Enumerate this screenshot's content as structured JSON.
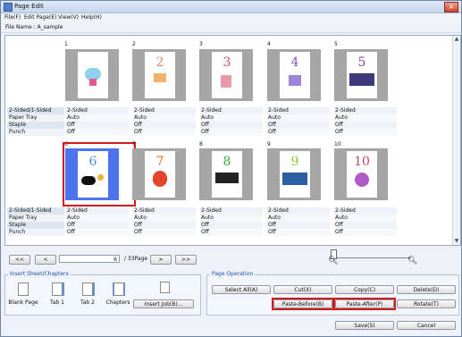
{
  "window": {
    "title": "Page Edit",
    "close_glyph": "×"
  },
  "menu": {
    "items": [
      "File(F)",
      "Edit Page(E)",
      "View(V)",
      "Help(H)"
    ]
  },
  "file_name": "File Name : A_sample",
  "row_labels": [
    "2-Sided/1-Sided",
    "Paper Tray",
    "Staple",
    "Punch"
  ],
  "pages": [
    {
      "num": "1",
      "glyph": "",
      "values": [
        "2-Sided",
        "Auto",
        "Off",
        "Off"
      ]
    },
    {
      "num": "2",
      "glyph": "2",
      "values": [
        "2-Sided",
        "Auto",
        "Off",
        "Off"
      ]
    },
    {
      "num": "3",
      "glyph": "3",
      "values": [
        "2-Sided",
        "Auto",
        "Off",
        "Off"
      ]
    },
    {
      "num": "4",
      "glyph": "4",
      "values": [
        "2-Sided",
        "Auto",
        "Off",
        "Off"
      ]
    },
    {
      "num": "5",
      "glyph": "5",
      "values": [
        "2-Sided",
        "Auto",
        "Off",
        "Off"
      ]
    },
    {
      "num": "6",
      "glyph": "6",
      "values": [
        "2-Sided",
        "Auto",
        "Off",
        "Off"
      ],
      "selected": true
    },
    {
      "num": "7",
      "glyph": "7",
      "values": [
        "2-Sided",
        "Auto",
        "Off",
        "Off"
      ]
    },
    {
      "num": "8",
      "glyph": "8",
      "values": [
        "2-Sided",
        "Auto",
        "Off",
        "Off"
      ]
    },
    {
      "num": "9",
      "glyph": "9",
      "values": [
        "2-Sided",
        "Auto",
        "Off",
        "Off"
      ]
    },
    {
      "num": "10",
      "glyph": "10",
      "values": [
        "2-Sided",
        "Auto",
        "Off",
        "Off"
      ]
    }
  ],
  "nav": {
    "first": "<<",
    "prev": "<",
    "next": ">",
    "last": ">>",
    "current_page": "6",
    "total": "/ 33Page"
  },
  "insert_group": {
    "title": "Insert Sheet/Chapters",
    "items": [
      "Blank Page",
      "Tab 1",
      "Tab 2",
      "Chapters"
    ],
    "insert_job": "Insert Job(B)..."
  },
  "page_operation": {
    "title": "Page Operation",
    "select_all": "Select All(A)",
    "cut": "Cut(X)",
    "copy": "Copy(C)",
    "delete": "Delete(D)",
    "paste_before": "Paste-Before(B)",
    "paste_after": "Paste-After(P)",
    "rotate": "Rotate(T)"
  },
  "footer": {
    "save": "Save(S)",
    "cancel": "Cancel"
  },
  "colors": {
    "highlight": "#d11a1a",
    "selected": "#4c74ee"
  }
}
